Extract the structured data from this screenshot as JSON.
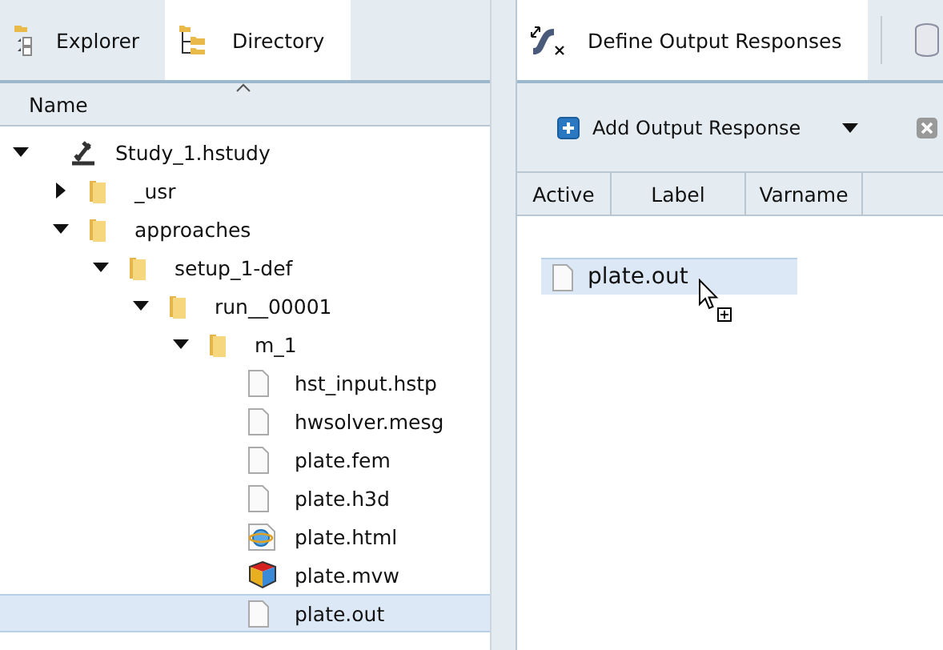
{
  "left_tabs": [
    {
      "label": "Explorer",
      "selected": false
    },
    {
      "label": "Directory",
      "selected": true
    }
  ],
  "right_tabs": [
    {
      "label": "Define Output Responses",
      "selected": true
    },
    {
      "selected": false
    }
  ],
  "tree": {
    "column": "Name",
    "items": [
      {
        "label": "Study_1.hstudy",
        "kind": "study",
        "expanded": true,
        "selected": false,
        "children": [
          {
            "label": "_usr",
            "kind": "folder",
            "expanded": false,
            "selected": false
          },
          {
            "label": "approaches",
            "kind": "folder",
            "expanded": true,
            "selected": false,
            "children": [
              {
                "label": "setup_1-def",
                "kind": "folder",
                "expanded": true,
                "selected": false,
                "children": [
                  {
                    "label": "run__00001",
                    "kind": "folder",
                    "expanded": true,
                    "selected": false,
                    "children": [
                      {
                        "label": "m_1",
                        "kind": "folder",
                        "expanded": true,
                        "selected": false,
                        "children": [
                          {
                            "label": "hst_input.hstp",
                            "kind": "file",
                            "selected": false
                          },
                          {
                            "label": "hwsolver.mesg",
                            "kind": "file",
                            "selected": false
                          },
                          {
                            "label": "plate.fem",
                            "kind": "file",
                            "selected": false
                          },
                          {
                            "label": "plate.h3d",
                            "kind": "file",
                            "selected": false
                          },
                          {
                            "label": "plate.html",
                            "kind": "web",
                            "selected": false
                          },
                          {
                            "label": "plate.mvw",
                            "kind": "cube",
                            "selected": false
                          },
                          {
                            "label": "plate.out",
                            "kind": "file",
                            "selected": true
                          }
                        ]
                      }
                    ]
                  }
                ]
              }
            ]
          }
        ]
      }
    ]
  },
  "toolbar": {
    "add_button": "Add Output Response"
  },
  "columns": [
    "Active",
    "Label",
    "Varname"
  ],
  "drag_item": {
    "label": "plate.out"
  }
}
